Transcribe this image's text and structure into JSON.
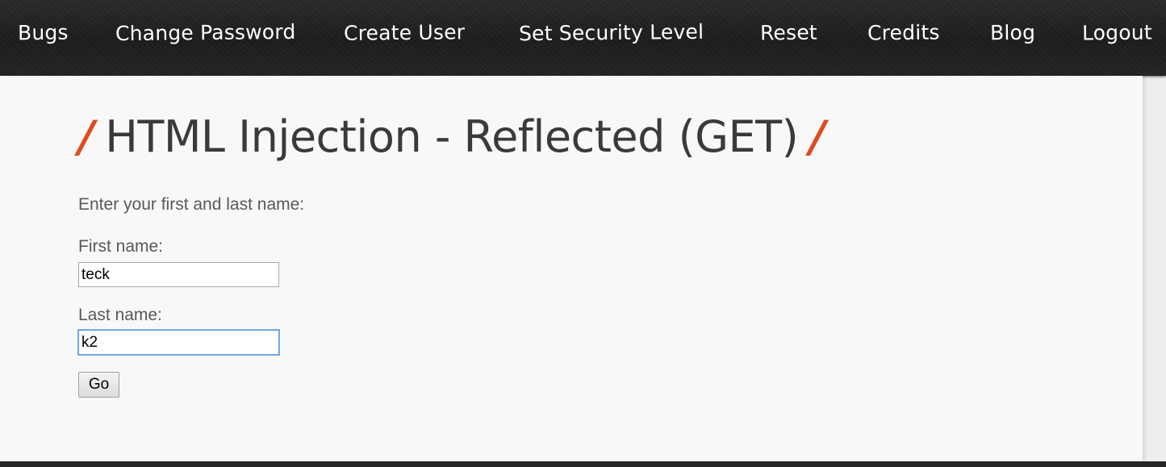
{
  "nav": {
    "items": [
      {
        "label": "Bugs"
      },
      {
        "label": "Change Password"
      },
      {
        "label": "Create User"
      },
      {
        "label": "Set Security Level"
      },
      {
        "label": "Reset"
      },
      {
        "label": "Credits"
      },
      {
        "label": "Blog"
      },
      {
        "label": "Logout"
      }
    ]
  },
  "page": {
    "title": "HTML Injection - Reflected (GET)",
    "title_slash": "/",
    "intro": "Enter your first and last name:"
  },
  "form": {
    "first_name_label": "First name:",
    "first_name_value": "teck",
    "last_name_label": "Last name:",
    "last_name_value": "k2",
    "submit_label": "Go"
  },
  "colors": {
    "accent": "#e04a1f",
    "nav_background": "#222222",
    "text": "#595959"
  }
}
